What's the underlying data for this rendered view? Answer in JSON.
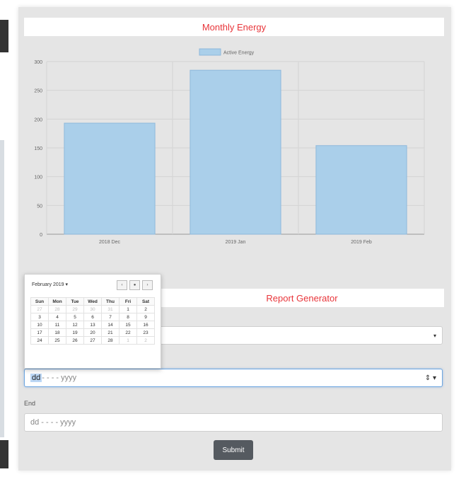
{
  "chart_panel": {
    "title": "Monthly Energy"
  },
  "chart_data": {
    "type": "bar",
    "categories": [
      "2018 Dec",
      "2019 Jan",
      "2019 Feb"
    ],
    "series": [
      {
        "name": "Active Energy",
        "values": [
          193,
          285,
          154
        ]
      }
    ],
    "ylim": [
      0,
      300
    ],
    "yticks": [
      0,
      50,
      100,
      150,
      200,
      250,
      300
    ],
    "legend": "top",
    "grid": true,
    "color": "#aacfea",
    "border_color": "#8fb8db"
  },
  "report": {
    "title": "Report Generator",
    "start_field": {
      "seg_day": "dd",
      "rest": " - - - - yyyy",
      "spinner": "⇕",
      "caret": "▾"
    },
    "end_label": "End",
    "end_field": {
      "placeholder": "dd - - - - yyyy"
    },
    "select_caret": "▾",
    "submit_label": "Submit"
  },
  "calendar": {
    "month_label": "February 2019 ▾",
    "nav": [
      "‹",
      "●",
      "›"
    ],
    "weekdays": [
      "Sun",
      "Mon",
      "Tue",
      "Wed",
      "Thu",
      "Fri",
      "Sat"
    ],
    "weeks": [
      [
        "27",
        "28",
        "29",
        "30",
        "31",
        "1",
        "2"
      ],
      [
        "3",
        "4",
        "5",
        "6",
        "7",
        "8",
        "9"
      ],
      [
        "10",
        "11",
        "12",
        "13",
        "14",
        "15",
        "16"
      ],
      [
        "17",
        "18",
        "19",
        "20",
        "21",
        "22",
        "23"
      ],
      [
        "24",
        "25",
        "26",
        "27",
        "28",
        "1",
        "2"
      ]
    ]
  }
}
